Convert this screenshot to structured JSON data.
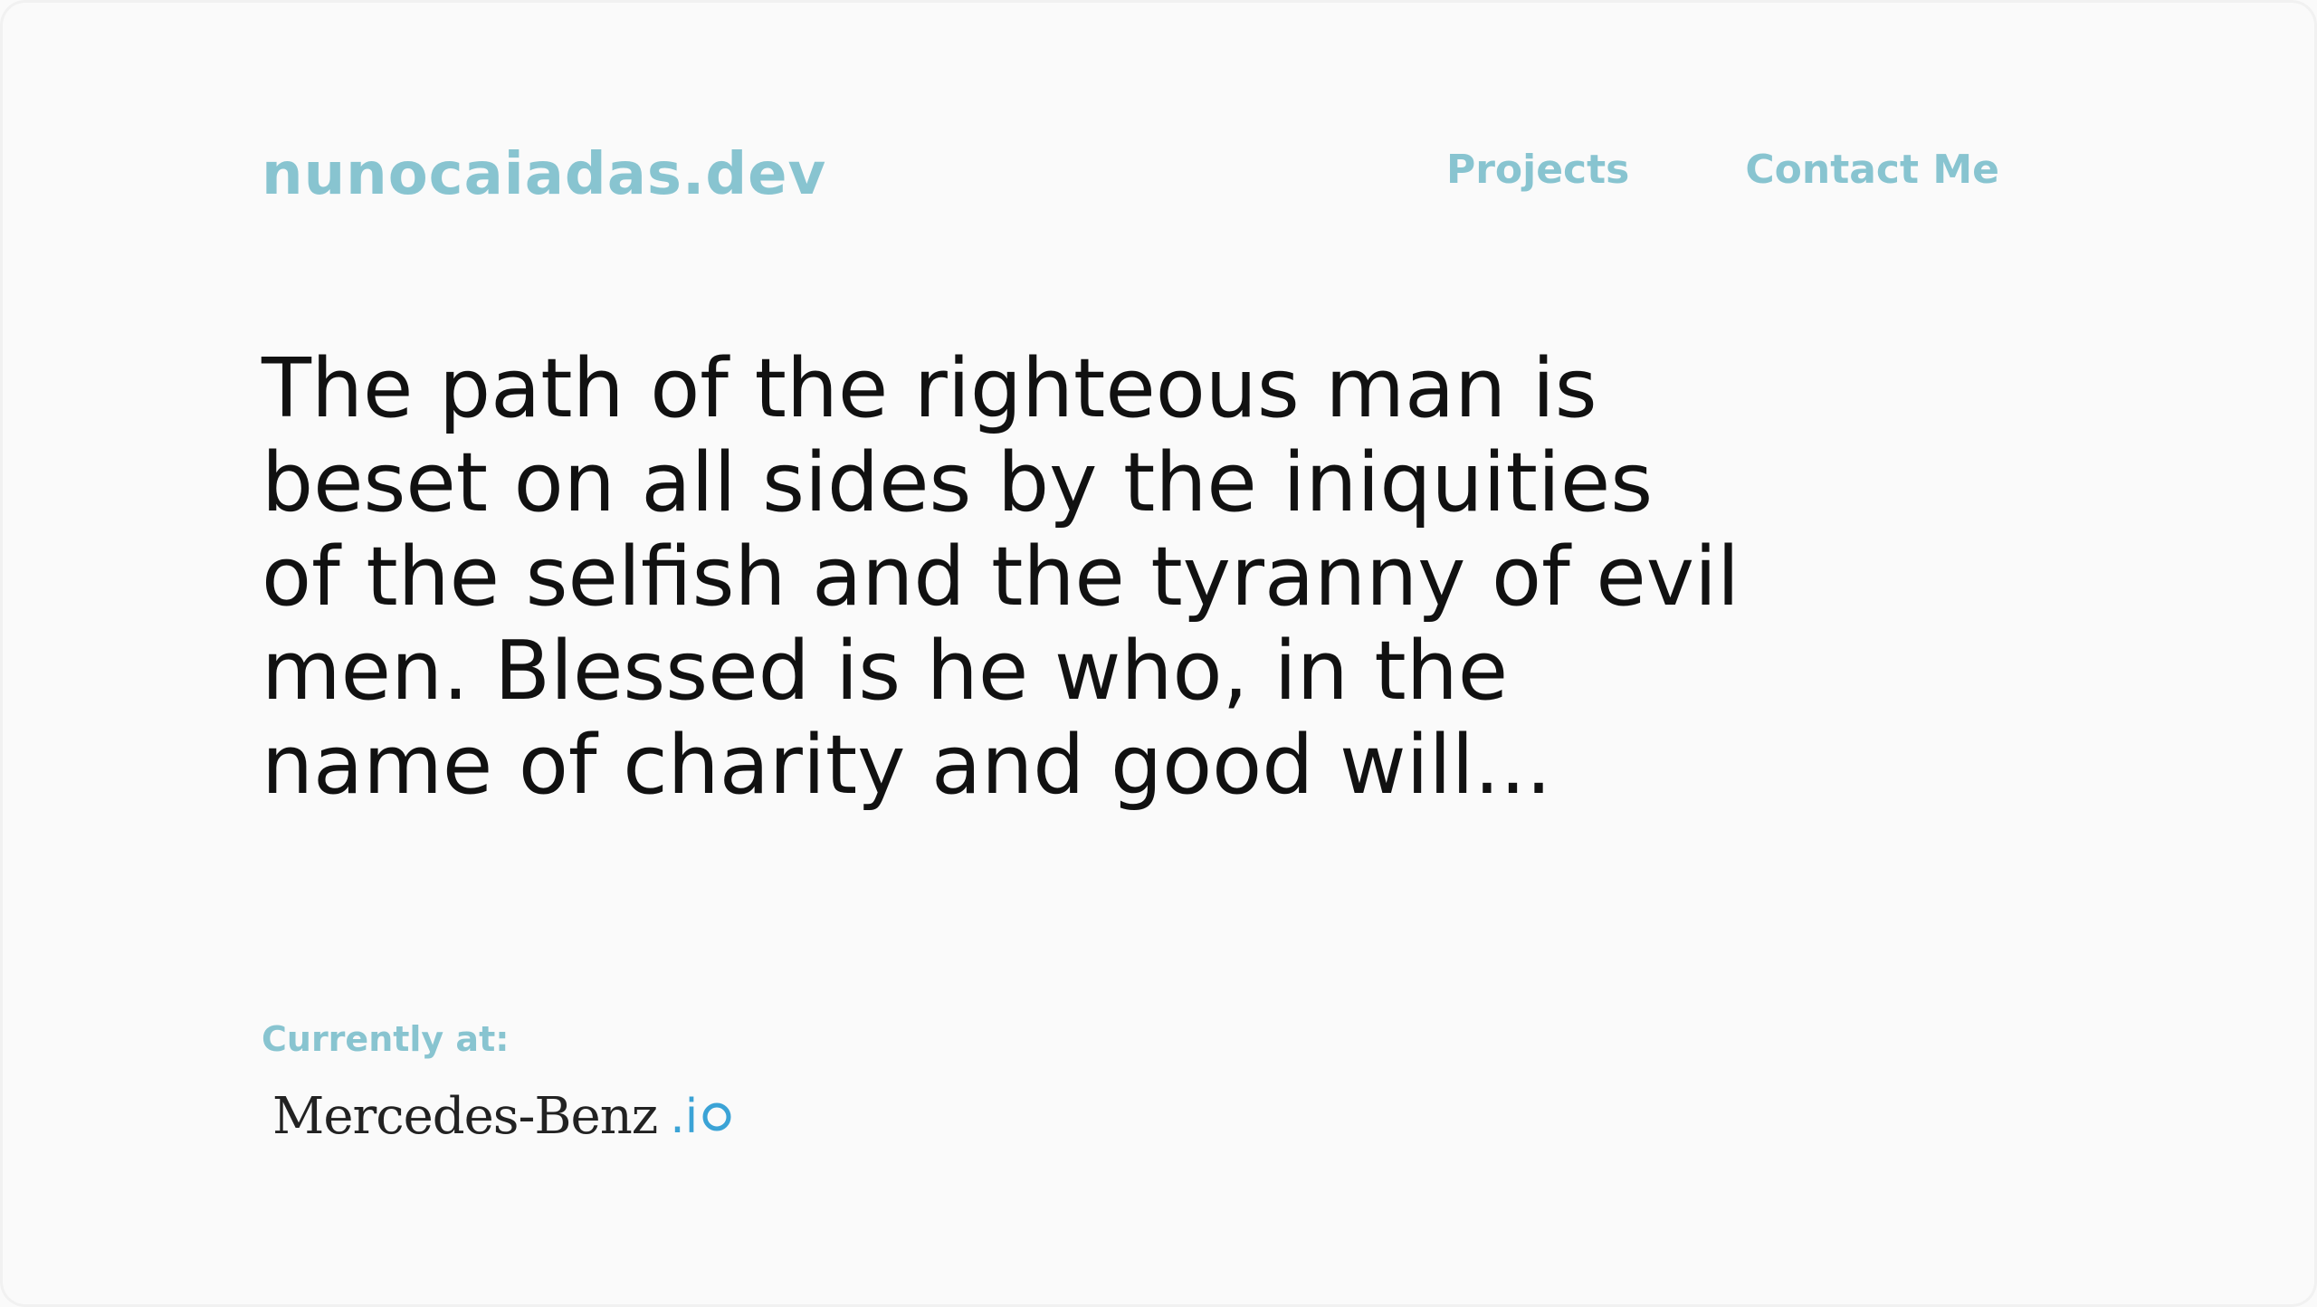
{
  "header": {
    "brand": "nunocaiadas.dev",
    "nav": [
      {
        "label": "Projects"
      },
      {
        "label": "Contact Me"
      }
    ]
  },
  "hero": {
    "quote": "The path of the righteous man is beset on all sides by the iniquities of the selfish and the tyranny of evil men. Blessed is he who, in the name of charity and good will..."
  },
  "currently": {
    "label": "Currently at:",
    "company": "Mercedes-Benz",
    "company_suffix": ".iO",
    "suffix_prefix": ".i"
  },
  "colors": {
    "background": "#fafafa",
    "accent": "#88c4d0",
    "text": "#111111",
    "logo_blue": "#3ba3d6"
  }
}
